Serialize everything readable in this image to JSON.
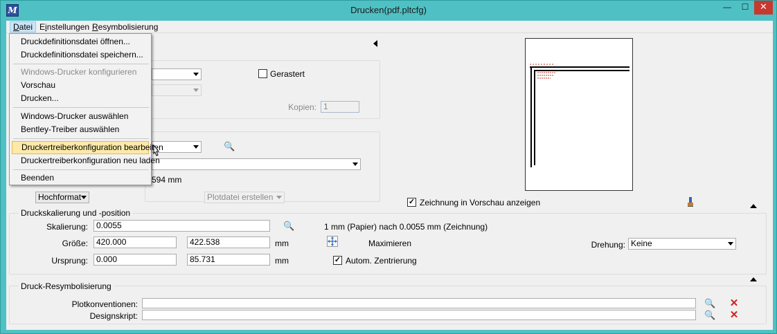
{
  "window": {
    "title": "Drucken(pdf.pltcfg)",
    "controls": {
      "minimize": "—",
      "maximize": "☐",
      "close": "✕"
    },
    "accent": "#4fc1c4"
  },
  "menubar": {
    "items": [
      {
        "label": "Datei",
        "mnemonic": "D"
      },
      {
        "label": "Einstellungen",
        "mnemonic": "i"
      },
      {
        "label": "Resymbolisierung",
        "mnemonic": "R"
      }
    ]
  },
  "file_menu": {
    "items": [
      {
        "label": "Druckdefinitionsdatei öffnen...",
        "enabled": true
      },
      {
        "label": "Druckdefinitionsdatei speichern...",
        "enabled": true
      },
      {
        "label": "Windows-Drucker konfigurieren",
        "enabled": false
      },
      {
        "label": "Vorschau",
        "enabled": true
      },
      {
        "label": "Drucken...",
        "enabled": true
      },
      {
        "label": "Windows-Drucker auswählen",
        "enabled": true
      },
      {
        "label": "Bentley-Treiber auswählen",
        "enabled": true
      },
      {
        "label": "Druckertreiberkonfiguration bearbeiten",
        "enabled": true,
        "highlighted": true
      },
      {
        "label": "Druckertreiberkonfiguration neu laden",
        "enabled": true
      },
      {
        "label": "Beenden",
        "enabled": true
      }
    ]
  },
  "general": {
    "gerastert_label": "Gerastert",
    "gerastert_checked": false,
    "kopien_label": "Kopien:",
    "kopien_value": "1"
  },
  "printer": {
    "paper_size_suffix": "594 mm",
    "orientation": "Hochformat",
    "output_mode": "Plotdatei erstellen"
  },
  "preview": {
    "show_drawing_label": "Zeichnung in Vorschau anzeigen",
    "show_drawing_checked": true
  },
  "scaling": {
    "group_label": "Druckskalierung und -position",
    "skalierung_label": "Skalierung:",
    "skalierung_value": "0.0055",
    "scale_text": "1 mm (Papier) nach 0.0055 mm (Zeichnung)",
    "groesse_label": "Größe:",
    "groesse_x": "420.000",
    "groesse_y": "422.538",
    "groesse_unit": "mm",
    "maximieren_label": "Maximieren",
    "drehung_label": "Drehung:",
    "drehung_value": "Keine",
    "ursprung_label": "Ursprung:",
    "ursprung_x": "0.000",
    "ursprung_y": "85.731",
    "ursprung_unit": "mm",
    "autom_label": "Autom. Zentrierung",
    "autom_checked": true
  },
  "resym": {
    "group_label": "Druck-Resymbolisierung",
    "plotkonventionen_label": "Plotkonventionen:",
    "plotkonventionen_value": "",
    "designskript_label": "Designskript:",
    "designskript_value": ""
  },
  "icons": {
    "magnifier": "🔍",
    "delete": "✕",
    "check": "✓"
  }
}
